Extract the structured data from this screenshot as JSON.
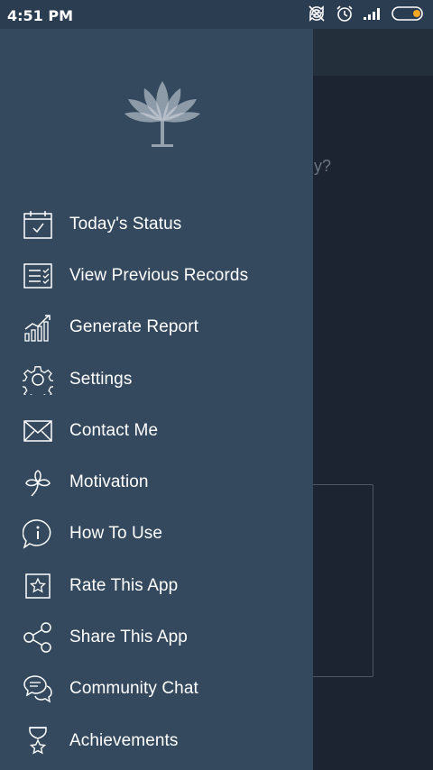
{
  "status_bar": {
    "time": "4:51 PM",
    "battery_level": 0.25
  },
  "background": {
    "partial_text": "y?"
  },
  "drawer": {
    "menu": [
      {
        "label": "Today's Status",
        "icon": "calendar-check-icon"
      },
      {
        "label": "View Previous Records",
        "icon": "list-check-icon"
      },
      {
        "label": "Generate Report",
        "icon": "bar-chart-icon"
      },
      {
        "label": "Settings",
        "icon": "gear-icon"
      },
      {
        "label": "Contact Me",
        "icon": "envelope-icon"
      },
      {
        "label": "Motivation",
        "icon": "clover-icon"
      },
      {
        "label": "How To Use",
        "icon": "info-bubble-icon"
      },
      {
        "label": "Rate This App",
        "icon": "star-icon"
      },
      {
        "label": "Share This App",
        "icon": "share-icon"
      },
      {
        "label": "Community Chat",
        "icon": "chat-bubbles-icon"
      },
      {
        "label": "Achievements",
        "icon": "trophy-star-icon"
      }
    ]
  },
  "colors": {
    "drawer_bg": "#34495e",
    "status_bar_bg": "#2b3d51",
    "screen_bg": "#1b2430",
    "text": "#ffffff",
    "battery_accent": "#f5a623"
  }
}
